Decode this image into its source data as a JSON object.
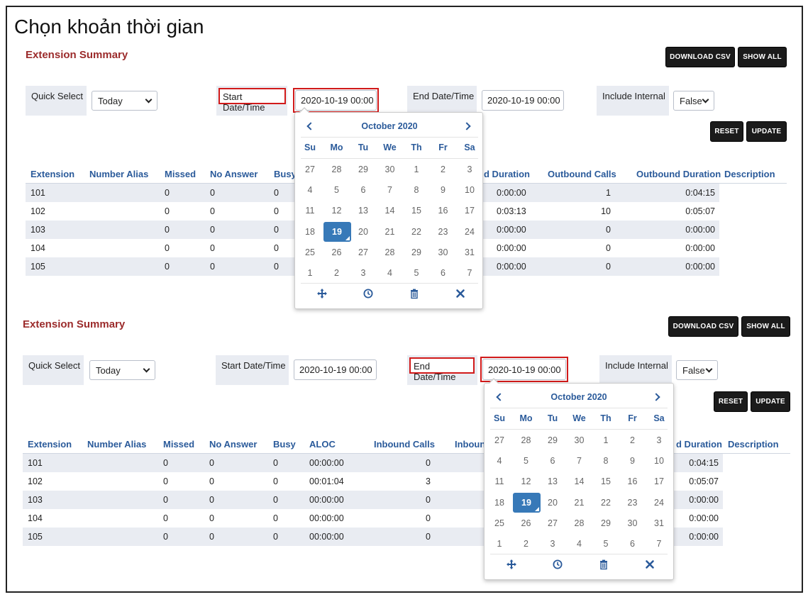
{
  "heading": "Chọn khoản thời gian",
  "panels": [
    {
      "title": "Extension Summary",
      "download_label": "DOWNLOAD CSV",
      "show_all_label": "SHOW ALL",
      "reset_label": "RESET",
      "update_label": "UPDATE",
      "quick_select_label": "Quick Select",
      "quick_select_value": "Today",
      "start_label": "Start Date/Time",
      "start_value": "2020-10-19 00:00",
      "end_label": "End Date/Time",
      "end_value": "2020-10-19 00:00",
      "include_internal_label": "Include Internal",
      "include_internal_value": "False",
      "headers": [
        "Extension",
        "Number Alias",
        "Missed",
        "No Answer",
        "Busy",
        "d Duration",
        "Outbound Calls",
        "Outbound Duration",
        "Description"
      ],
      "rows": [
        [
          "101",
          "",
          "0",
          "0",
          "0",
          "0:00:00",
          "1",
          "0:04:15",
          ""
        ],
        [
          "102",
          "",
          "0",
          "0",
          "0",
          "0:03:13",
          "10",
          "0:05:07",
          ""
        ],
        [
          "103",
          "",
          "0",
          "0",
          "0",
          "0:00:00",
          "0",
          "0:00:00",
          ""
        ],
        [
          "104",
          "",
          "0",
          "0",
          "0",
          "0:00:00",
          "0",
          "0:00:00",
          ""
        ],
        [
          "105",
          "",
          "0",
          "0",
          "0",
          "0:00:00",
          "0",
          "0:00:00",
          ""
        ]
      ]
    },
    {
      "title": "Extension Summary",
      "download_label": "DOWNLOAD CSV",
      "show_all_label": "SHOW ALL",
      "reset_label": "RESET",
      "update_label": "UPDATE",
      "quick_select_label": "Quick Select",
      "quick_select_value": "Today",
      "start_label": "Start Date/Time",
      "start_value": "2020-10-19 00:00",
      "end_label": "End Date/Time",
      "end_value": "2020-10-19 00:00",
      "include_internal_label": "Include Internal",
      "include_internal_value": "False",
      "headers": [
        "Extension",
        "Number Alias",
        "Missed",
        "No Answer",
        "Busy",
        "ALOC",
        "Inbound Calls",
        "Inboun",
        "d Duration",
        "Description"
      ],
      "rows": [
        [
          "101",
          "",
          "0",
          "0",
          "0",
          "00:00:00",
          "0",
          "0:04:15",
          ""
        ],
        [
          "102",
          "",
          "0",
          "0",
          "0",
          "00:01:04",
          "3",
          "0:05:07",
          ""
        ],
        [
          "103",
          "",
          "0",
          "0",
          "0",
          "00:00:00",
          "0",
          "0:00:00",
          ""
        ],
        [
          "104",
          "",
          "0",
          "0",
          "0",
          "00:00:00",
          "0",
          "0:00:00",
          ""
        ],
        [
          "105",
          "",
          "0",
          "0",
          "0",
          "00:00:00",
          "0",
          "0:00:00",
          ""
        ]
      ]
    }
  ],
  "calendar": {
    "month": "October 2020",
    "dow": [
      "Su",
      "Mo",
      "Tu",
      "We",
      "Th",
      "Fr",
      "Sa"
    ],
    "weeks": [
      [
        "27",
        "28",
        "29",
        "30",
        "1",
        "2",
        "3"
      ],
      [
        "4",
        "5",
        "6",
        "7",
        "8",
        "9",
        "10"
      ],
      [
        "11",
        "12",
        "13",
        "14",
        "15",
        "16",
        "17"
      ],
      [
        "18",
        "19",
        "20",
        "21",
        "22",
        "23",
        "24"
      ],
      [
        "25",
        "26",
        "27",
        "28",
        "29",
        "30",
        "31"
      ],
      [
        "1",
        "2",
        "3",
        "4",
        "5",
        "6",
        "7"
      ]
    ],
    "selected": "19",
    "icons": [
      "move-icon",
      "clock-icon",
      "trash-icon",
      "close-icon"
    ]
  },
  "colors": {
    "title": "#9b2b2b",
    "accent": "#2a5a9a",
    "selected": "#3779b8",
    "highlight": "#d11a1a",
    "row_alt": "#e9ecf2"
  }
}
